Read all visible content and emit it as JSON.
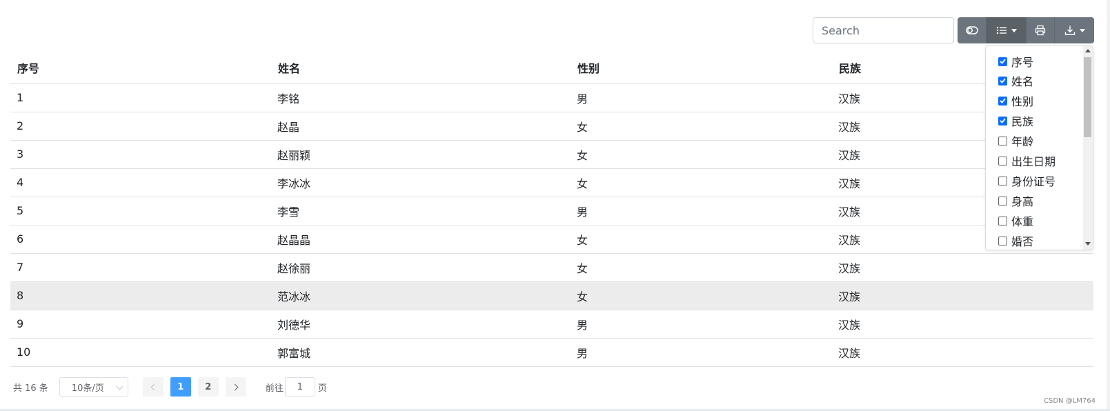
{
  "toolbar": {
    "search_placeholder": "Search",
    "buttons": [
      {
        "name": "toggle",
        "icon": "toggle-icon"
      },
      {
        "name": "columns",
        "icon": "list-icon",
        "dropdown": true
      },
      {
        "name": "print",
        "icon": "printer-icon"
      },
      {
        "name": "export",
        "icon": "download-icon",
        "dropdown": true
      }
    ]
  },
  "table": {
    "headers": [
      "序号",
      "姓名",
      "性别",
      "民族"
    ],
    "rows": [
      [
        "1",
        "李铭",
        "男",
        "汉族"
      ],
      [
        "2",
        "赵晶",
        "女",
        "汉族"
      ],
      [
        "3",
        "赵丽颖",
        "女",
        "汉族"
      ],
      [
        "4",
        "李冰冰",
        "女",
        "汉族"
      ],
      [
        "5",
        "李雪",
        "男",
        "汉族"
      ],
      [
        "6",
        "赵晶晶",
        "女",
        "汉族"
      ],
      [
        "7",
        "赵徐丽",
        "女",
        "汉族"
      ],
      [
        "8",
        "范冰冰",
        "女",
        "汉族"
      ],
      [
        "9",
        "刘德华",
        "男",
        "汉族"
      ],
      [
        "10",
        "郭富城",
        "男",
        "汉族"
      ]
    ],
    "hovered_row": 8
  },
  "columns_menu": {
    "items": [
      {
        "label": "序号",
        "checked": true
      },
      {
        "label": "姓名",
        "checked": true
      },
      {
        "label": "性别",
        "checked": true
      },
      {
        "label": "民族",
        "checked": true
      },
      {
        "label": "年龄",
        "checked": false
      },
      {
        "label": "出生日期",
        "checked": false
      },
      {
        "label": "身份证号",
        "checked": false
      },
      {
        "label": "身高",
        "checked": false
      },
      {
        "label": "体重",
        "checked": false
      },
      {
        "label": "婚否",
        "checked": false
      }
    ]
  },
  "pagination": {
    "total": "共 16 条",
    "page_size": "10条/页",
    "pages": [
      "1",
      "2"
    ],
    "current_page": "1",
    "goto_prefix": "前往",
    "goto_value": "1",
    "goto_suffix": "页"
  },
  "watermark": "CSDN @LM764",
  "colors": {
    "toolbar_button": "#6c757d",
    "active_page": "#409eff",
    "checkbox": "#0d6efd",
    "hover_row": "#ececec"
  }
}
